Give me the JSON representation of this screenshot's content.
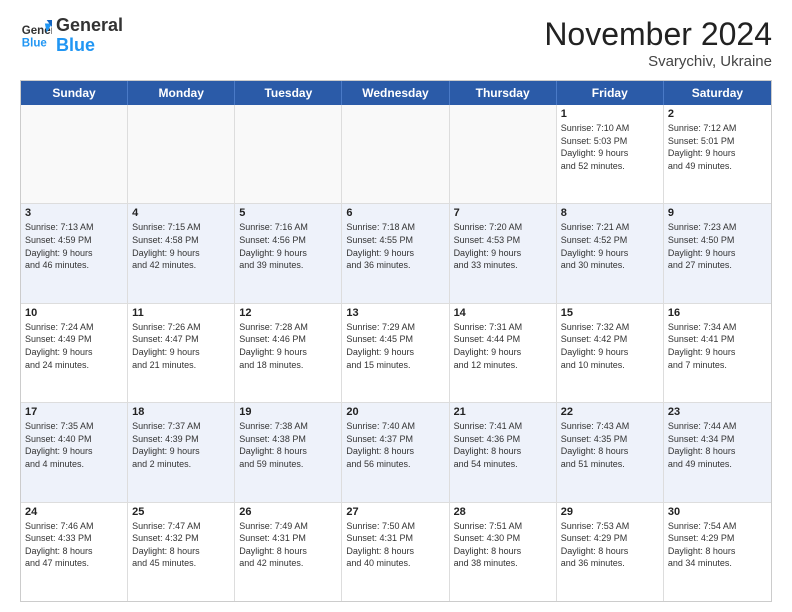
{
  "logo": {
    "general": "General",
    "blue": "Blue"
  },
  "header": {
    "month": "November 2024",
    "location": "Svarychiv, Ukraine"
  },
  "weekdays": [
    "Sunday",
    "Monday",
    "Tuesday",
    "Wednesday",
    "Thursday",
    "Friday",
    "Saturday"
  ],
  "rows": [
    [
      {
        "day": "",
        "info": ""
      },
      {
        "day": "",
        "info": ""
      },
      {
        "day": "",
        "info": ""
      },
      {
        "day": "",
        "info": ""
      },
      {
        "day": "",
        "info": ""
      },
      {
        "day": "1",
        "info": "Sunrise: 7:10 AM\nSunset: 5:03 PM\nDaylight: 9 hours\nand 52 minutes."
      },
      {
        "day": "2",
        "info": "Sunrise: 7:12 AM\nSunset: 5:01 PM\nDaylight: 9 hours\nand 49 minutes."
      }
    ],
    [
      {
        "day": "3",
        "info": "Sunrise: 7:13 AM\nSunset: 4:59 PM\nDaylight: 9 hours\nand 46 minutes."
      },
      {
        "day": "4",
        "info": "Sunrise: 7:15 AM\nSunset: 4:58 PM\nDaylight: 9 hours\nand 42 minutes."
      },
      {
        "day": "5",
        "info": "Sunrise: 7:16 AM\nSunset: 4:56 PM\nDaylight: 9 hours\nand 39 minutes."
      },
      {
        "day": "6",
        "info": "Sunrise: 7:18 AM\nSunset: 4:55 PM\nDaylight: 9 hours\nand 36 minutes."
      },
      {
        "day": "7",
        "info": "Sunrise: 7:20 AM\nSunset: 4:53 PM\nDaylight: 9 hours\nand 33 minutes."
      },
      {
        "day": "8",
        "info": "Sunrise: 7:21 AM\nSunset: 4:52 PM\nDaylight: 9 hours\nand 30 minutes."
      },
      {
        "day": "9",
        "info": "Sunrise: 7:23 AM\nSunset: 4:50 PM\nDaylight: 9 hours\nand 27 minutes."
      }
    ],
    [
      {
        "day": "10",
        "info": "Sunrise: 7:24 AM\nSunset: 4:49 PM\nDaylight: 9 hours\nand 24 minutes."
      },
      {
        "day": "11",
        "info": "Sunrise: 7:26 AM\nSunset: 4:47 PM\nDaylight: 9 hours\nand 21 minutes."
      },
      {
        "day": "12",
        "info": "Sunrise: 7:28 AM\nSunset: 4:46 PM\nDaylight: 9 hours\nand 18 minutes."
      },
      {
        "day": "13",
        "info": "Sunrise: 7:29 AM\nSunset: 4:45 PM\nDaylight: 9 hours\nand 15 minutes."
      },
      {
        "day": "14",
        "info": "Sunrise: 7:31 AM\nSunset: 4:44 PM\nDaylight: 9 hours\nand 12 minutes."
      },
      {
        "day": "15",
        "info": "Sunrise: 7:32 AM\nSunset: 4:42 PM\nDaylight: 9 hours\nand 10 minutes."
      },
      {
        "day": "16",
        "info": "Sunrise: 7:34 AM\nSunset: 4:41 PM\nDaylight: 9 hours\nand 7 minutes."
      }
    ],
    [
      {
        "day": "17",
        "info": "Sunrise: 7:35 AM\nSunset: 4:40 PM\nDaylight: 9 hours\nand 4 minutes."
      },
      {
        "day": "18",
        "info": "Sunrise: 7:37 AM\nSunset: 4:39 PM\nDaylight: 9 hours\nand 2 minutes."
      },
      {
        "day": "19",
        "info": "Sunrise: 7:38 AM\nSunset: 4:38 PM\nDaylight: 8 hours\nand 59 minutes."
      },
      {
        "day": "20",
        "info": "Sunrise: 7:40 AM\nSunset: 4:37 PM\nDaylight: 8 hours\nand 56 minutes."
      },
      {
        "day": "21",
        "info": "Sunrise: 7:41 AM\nSunset: 4:36 PM\nDaylight: 8 hours\nand 54 minutes."
      },
      {
        "day": "22",
        "info": "Sunrise: 7:43 AM\nSunset: 4:35 PM\nDaylight: 8 hours\nand 51 minutes."
      },
      {
        "day": "23",
        "info": "Sunrise: 7:44 AM\nSunset: 4:34 PM\nDaylight: 8 hours\nand 49 minutes."
      }
    ],
    [
      {
        "day": "24",
        "info": "Sunrise: 7:46 AM\nSunset: 4:33 PM\nDaylight: 8 hours\nand 47 minutes."
      },
      {
        "day": "25",
        "info": "Sunrise: 7:47 AM\nSunset: 4:32 PM\nDaylight: 8 hours\nand 45 minutes."
      },
      {
        "day": "26",
        "info": "Sunrise: 7:49 AM\nSunset: 4:31 PM\nDaylight: 8 hours\nand 42 minutes."
      },
      {
        "day": "27",
        "info": "Sunrise: 7:50 AM\nSunset: 4:31 PM\nDaylight: 8 hours\nand 40 minutes."
      },
      {
        "day": "28",
        "info": "Sunrise: 7:51 AM\nSunset: 4:30 PM\nDaylight: 8 hours\nand 38 minutes."
      },
      {
        "day": "29",
        "info": "Sunrise: 7:53 AM\nSunset: 4:29 PM\nDaylight: 8 hours\nand 36 minutes."
      },
      {
        "day": "30",
        "info": "Sunrise: 7:54 AM\nSunset: 4:29 PM\nDaylight: 8 hours\nand 34 minutes."
      }
    ]
  ]
}
